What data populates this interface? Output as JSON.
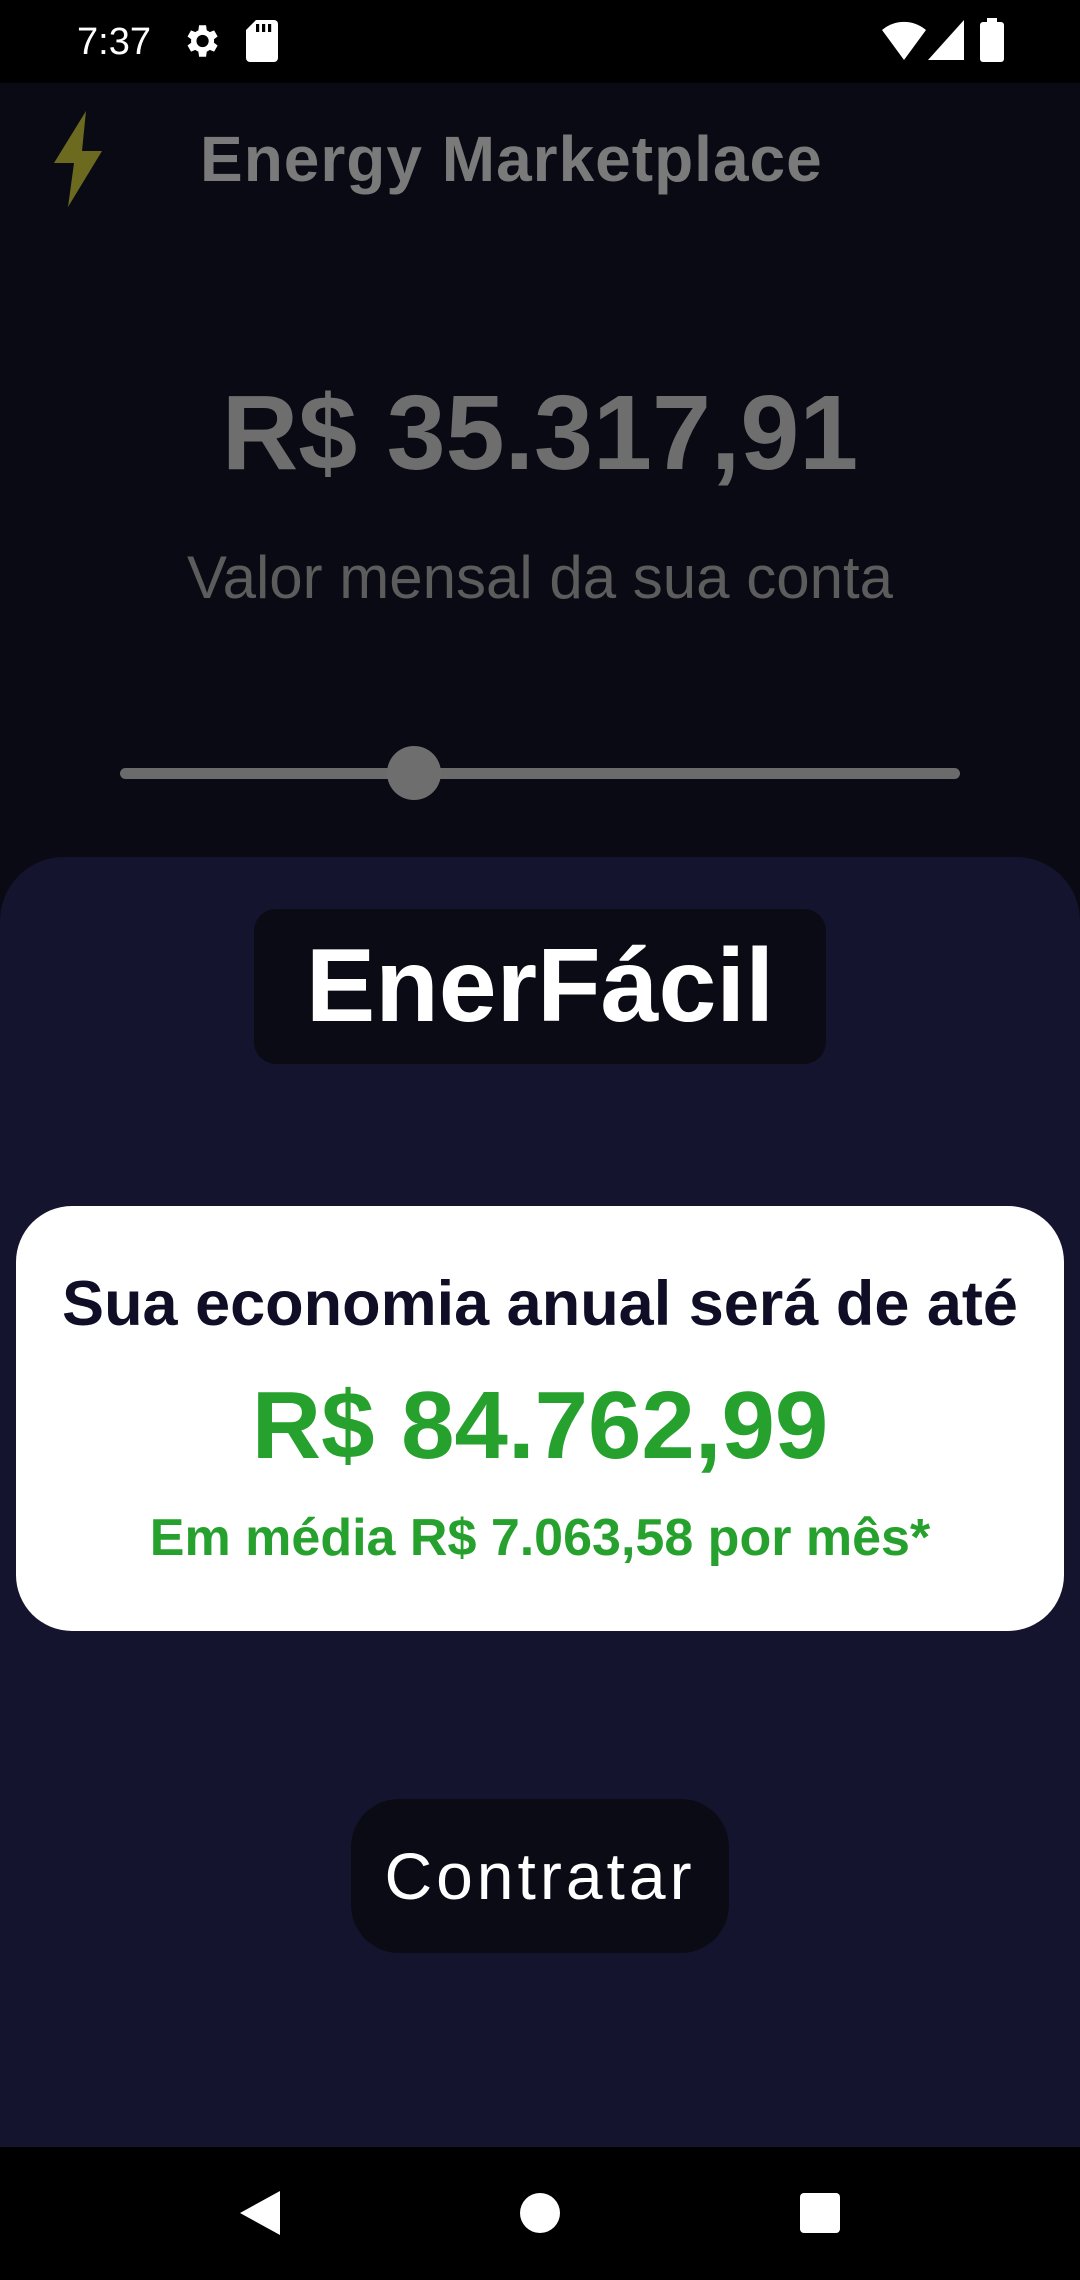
{
  "status_bar": {
    "time": "7:37",
    "icons": [
      "gear-icon",
      "sd-card-icon",
      "wifi-icon",
      "signal-icon",
      "battery-icon"
    ]
  },
  "toolbar": {
    "icon": "lightning-bolt-icon",
    "title": "Energy Marketplace"
  },
  "bill": {
    "value": "R$ 35.317,91",
    "caption": "Valor mensal da sua conta",
    "slider_level": 0.35
  },
  "sheet": {
    "brand": "EnerFácil",
    "savings_heading": "Sua economia anual será de até",
    "savings_value": "R$ 84.762,99",
    "savings_monthly": "Em média R$ 7.063,58 por mês*",
    "cta_label": "Contratar"
  },
  "nav_bar": {
    "buttons": [
      "back-icon",
      "home-icon",
      "recents-icon"
    ]
  },
  "colors": {
    "sheet_background": "#15142e",
    "savings_green": "#27a12e",
    "bolt": "#6b6a1e"
  }
}
